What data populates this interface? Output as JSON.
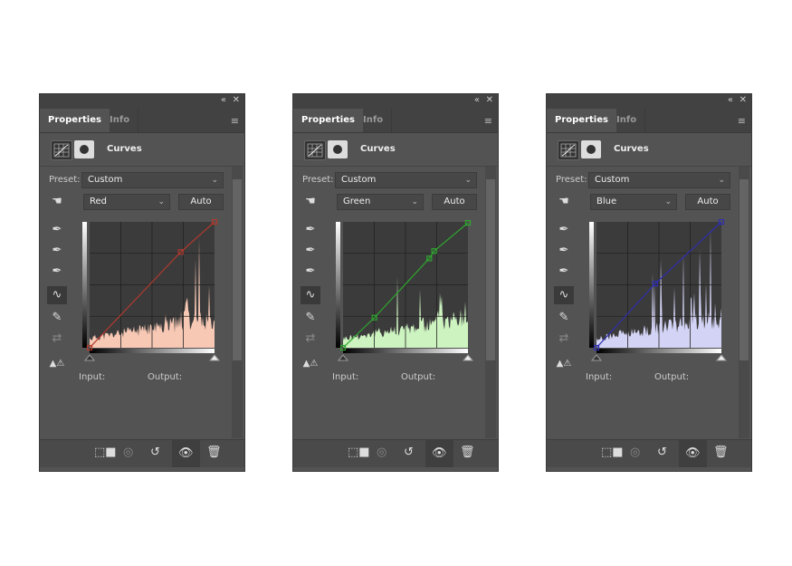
{
  "panels": [
    {
      "tab_active": "Properties",
      "tab_inactive": "Info",
      "title": "Curves",
      "preset_label": "Preset:",
      "preset_value": "Custom",
      "channel": "Red",
      "auto_label": "Auto",
      "input_label": "Input:",
      "output_label": "Output:",
      "curve_color": "#b03a2e",
      "hist_color": "#f7c8b4",
      "points": [
        [
          0,
          0
        ],
        [
          186,
          194
        ],
        [
          255,
          255
        ]
      ]
    },
    {
      "tab_active": "Properties",
      "tab_inactive": "Info",
      "title": "Curves",
      "preset_label": "Preset:",
      "preset_value": "Custom",
      "channel": "Green",
      "auto_label": "Auto",
      "input_label": "Input:",
      "output_label": "Output:",
      "curve_color": "#2fa52f",
      "hist_color": "#cdf3c0",
      "points": [
        [
          0,
          0
        ],
        [
          64,
          61
        ],
        [
          176,
          181
        ],
        [
          186,
          196
        ],
        [
          255,
          253
        ]
      ]
    },
    {
      "tab_active": "Properties",
      "tab_inactive": "Info",
      "title": "Curves",
      "preset_label": "Preset:",
      "preset_value": "Custom",
      "channel": "Blue",
      "auto_label": "Auto",
      "input_label": "Input:",
      "output_label": "Output:",
      "curve_color": "#2f2fb0",
      "hist_color": "#d3d3f5",
      "points": [
        [
          0,
          0
        ],
        [
          120,
          130
        ],
        [
          255,
          255
        ]
      ]
    }
  ],
  "icons": {
    "collapse": "double-chevron-left-icon",
    "close": "close-icon",
    "menu": "hamburger-menu-icon",
    "clip": "clip-to-layer-icon",
    "view_previous": "view-previous-icon",
    "reset": "reset-icon",
    "visibility": "eye-icon",
    "delete": "trash-icon"
  }
}
